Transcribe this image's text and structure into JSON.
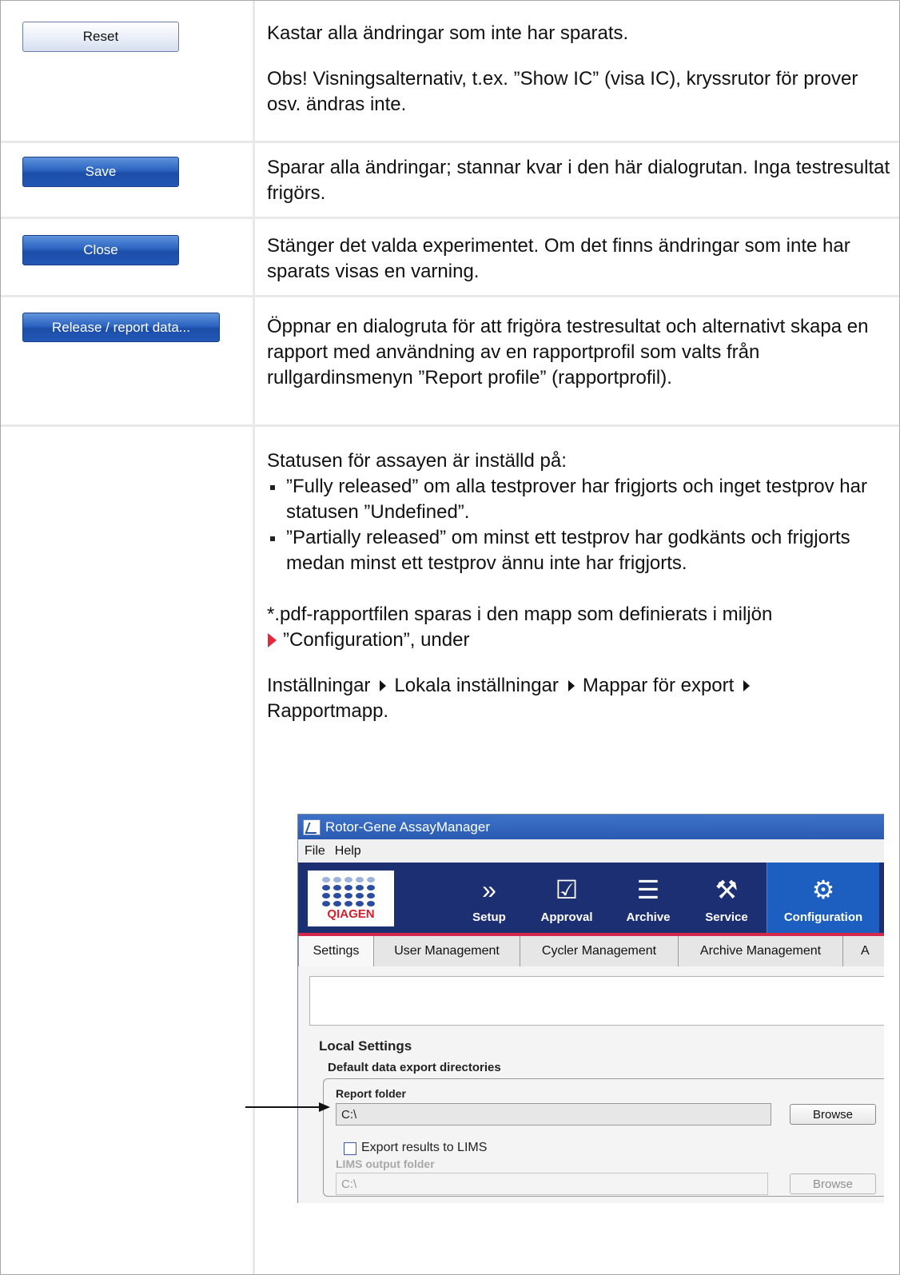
{
  "rows": [
    {
      "button": "Reset",
      "paragraphs": [
        "Kastar alla ändringar som inte har sparats.",
        "Obs! Visningsalternativ, t.ex. ”Show IC” (visa IC), kryssrutor för prover osv. ändras inte."
      ]
    },
    {
      "button": "Save",
      "text": "Sparar alla ändringar; stannar kvar i den här dialogrutan. Inga testresultat frigörs."
    },
    {
      "button": "Close",
      "text": "Stänger det valda experimentet. Om det finns ändringar som inte har sparats visas en varning."
    },
    {
      "button": "Release / report data...",
      "text": "Öppnar en dialogruta för att frigöra testresultat och alternativt skapa en rapport med användning av en rapportprofil som valts från rullgardinsmenyn ”Report profile” (rapportprofil)."
    }
  ],
  "status": {
    "intro": "Statusen för assayen är inställd på:",
    "bullets": [
      "”Fully released” om alla testprover har frigjorts och inget testprov har statusen ”Undefined”.",
      "”Partially released” om minst ett testprov har godkänts och frigjorts medan minst ett testprov ännu inte har frigjorts."
    ],
    "pdf_line1": "*.pdf-rapportfilen sparas i den mapp som definierats i miljön",
    "pdf_line2": "”Configuration”, under",
    "path": [
      "Inställningar",
      "Lokala inställningar",
      "Mappar för export",
      "Rapportmapp."
    ]
  },
  "app": {
    "title": "Rotor-Gene AssayManager",
    "menu": [
      "File",
      "Help"
    ],
    "logo_text": "QIAGEN",
    "nav": [
      "Setup",
      "Approval",
      "Archive",
      "Service",
      "Configuration"
    ],
    "nav_icons": [
      "»",
      "☑",
      "☰",
      "⚒",
      "⚙"
    ],
    "tabs": [
      "Settings",
      "User Management",
      "Cycler Management",
      "Archive Management",
      "A"
    ],
    "local_settings": "Local Settings",
    "group_title": "Default data export directories",
    "report_folder_label": "Report folder",
    "report_folder_value": "C:\\",
    "browse": "Browse",
    "export_lims_label": "Export results to LIMS",
    "lims_folder_label": "LIMS output folder",
    "lims_folder_value": "C:\\"
  },
  "colors": {
    "accent_blue": "#2c64c1",
    "header_navy": "#1d2f73",
    "red_accent": "#d5284a"
  }
}
